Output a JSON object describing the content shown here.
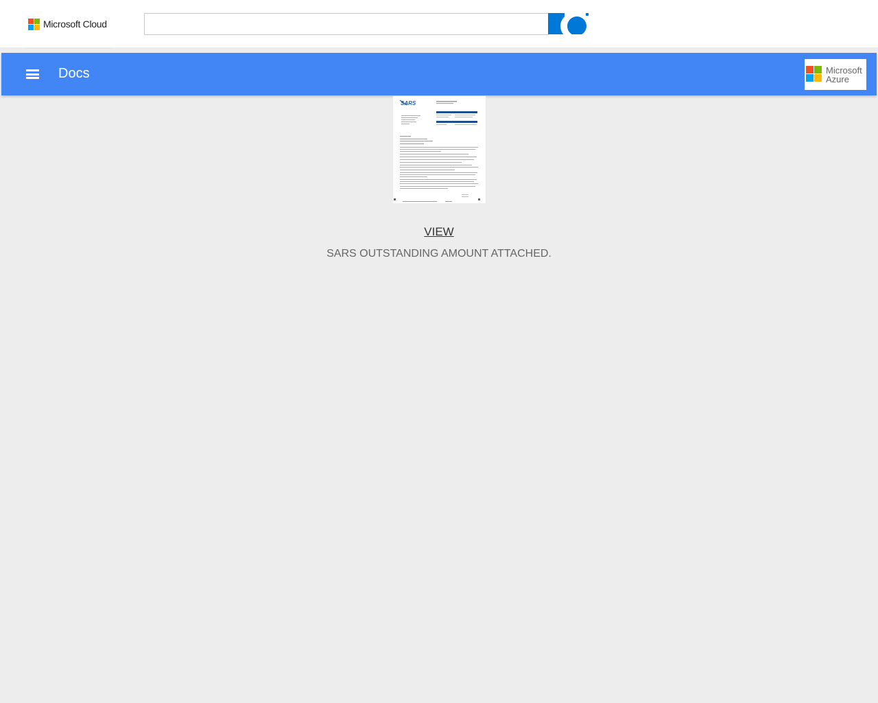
{
  "header": {
    "brand_text": "Microsoft Cloud",
    "search": {
      "value": "",
      "placeholder": ""
    },
    "search_icon": "search-icon"
  },
  "navbar": {
    "menu_icon": "hamburger-menu-icon",
    "title": "Docs",
    "azure_logo": {
      "line1": "Microsoft",
      "line2": "Azure"
    }
  },
  "main": {
    "document_thumbnail": {
      "logo_text": "SARS"
    },
    "view_label": "VIEW ",
    "message": "SARS OUTSTANDING AMOUNT ATTACHED."
  },
  "colors": {
    "navbar": "#4285f4",
    "search_button": "#0078d7",
    "background": "#ededed",
    "ms_red": "#f25022",
    "ms_green": "#7fba00",
    "ms_blue": "#00a4ef",
    "ms_yellow": "#ffb900"
  }
}
